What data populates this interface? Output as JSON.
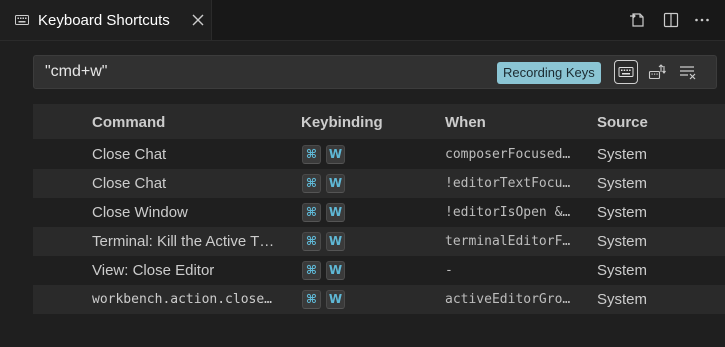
{
  "tab": {
    "title": "Keyboard Shortcuts",
    "icon": "keyboard-icon"
  },
  "editor_actions": [
    "open-json-icon",
    "split-editor-icon",
    "more-actions-icon"
  ],
  "search": {
    "value": "\"cmd+w\"",
    "recording_badge": "Recording Keys"
  },
  "table": {
    "headers": {
      "command": "Command",
      "keybinding": "Keybinding",
      "when": "When",
      "source": "Source"
    },
    "rows": [
      {
        "command": "Close Chat",
        "keys": [
          "⌘",
          "W"
        ],
        "when": "composerFocused…",
        "source": "System"
      },
      {
        "command": "Close Chat",
        "keys": [
          "⌘",
          "W"
        ],
        "when": "!editorTextFocu…",
        "source": "System"
      },
      {
        "command": "Close Window",
        "keys": [
          "⌘",
          "W"
        ],
        "when": "!editorIsOpen &…",
        "source": "System"
      },
      {
        "command": "Terminal: Kill the Active T…",
        "keys": [
          "⌘",
          "W"
        ],
        "when": "terminalEditorF…",
        "source": "System"
      },
      {
        "command": "View: Close Editor",
        "keys": [
          "⌘",
          "W"
        ],
        "when": "-",
        "source": "System"
      },
      {
        "command": "workbench.action.close…",
        "keys": [
          "⌘",
          "W"
        ],
        "when": "activeEditorGro…",
        "source": "System"
      }
    ]
  },
  "colors": {
    "background": "#1f1f1f",
    "badge": "#8bc5d4",
    "key_text": "#5fb8d6"
  }
}
